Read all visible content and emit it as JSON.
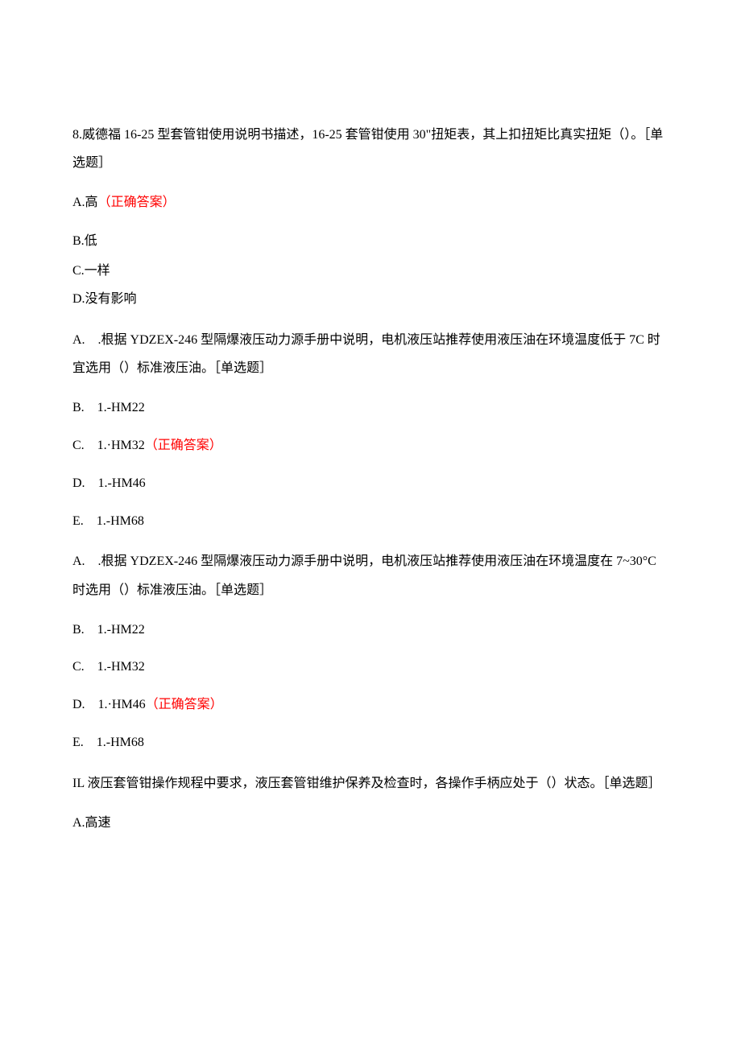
{
  "q8": {
    "text": "8.威德福 16-25 型套管钳使用说明书描述，16-25 套管钳使用 30\"扭矩表，其上扣扭矩比真实扭矩（）。［单选题］",
    "a": "A.高",
    "a_correct": "（正确答案）",
    "b": "B.低",
    "c": "C.一样",
    "d": "D.没有影响"
  },
  "q9": {
    "text": "A.　.根据 YDZEX-246 型隔爆液压动力源手册中说明，电机液压站推荐使用液压油在环境温度低于 7C 时宜选用（）标准液压油。［单选题］",
    "b": "B.　1.-HM22",
    "c": "C.　1.·HM32",
    "c_correct": "（正确答案）",
    "d": "D.　1.-HM46",
    "e": "E.　1.-HM68"
  },
  "q10": {
    "text": "A.　.根据 YDZEX-246 型隔爆液压动力源手册中说明，电机液压站推荐使用液压油在环境温度在 7~30°C 时选用（）标准液压油。［单选题］",
    "b": "B.　1.-HM22",
    "c": "C.　1.-HM32",
    "d": "D.　1.·HM46",
    "d_correct": "（正确答案）",
    "e": "E.　1.-HM68"
  },
  "q11": {
    "text": "IL 液压套管钳操作规程中要求，液压套管钳维护保养及检查时，各操作手柄应处于（）状态。［单选题］",
    "a": "A.高速"
  }
}
